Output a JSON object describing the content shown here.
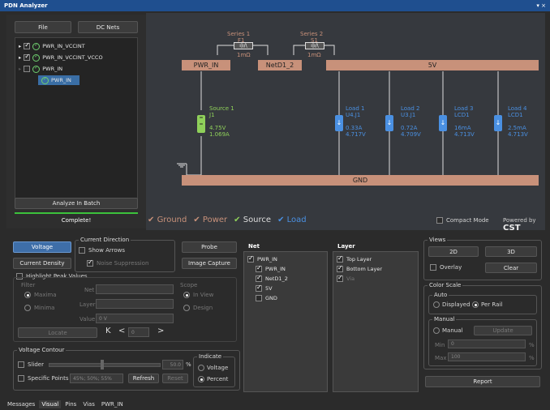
{
  "window": {
    "title": "PDN Analyzer",
    "controls": "▾ ×"
  },
  "left": {
    "file_btn": "File",
    "dcnets_btn": "DC Nets",
    "tree": [
      {
        "label": "PWR_IN_VCCINT"
      },
      {
        "label": "PWR_IN_VCCINT_VCCO"
      },
      {
        "label": "PWR_IN"
      },
      {
        "label": "PWR_IN"
      }
    ],
    "analyze_btn": "Analyze In Batch",
    "status": "Complete!"
  },
  "schem": {
    "series1": {
      "title": "Series 1",
      "ref": "F1",
      "val": "1mΩ"
    },
    "series2": {
      "title": "Series 2",
      "ref": "S1",
      "val": "1mΩ"
    },
    "nets": {
      "pwr_in": "PWR_IN",
      "netd1": "NetD1_2",
      "fivev": "5V",
      "gnd": "GND"
    },
    "source": {
      "title": "Source 1",
      "ref": "J1",
      "v": "4.75V",
      "i": "1.069A"
    },
    "loads": [
      {
        "title": "Load 1",
        "ref": "U4.J1",
        "a": "0.33A",
        "v": "4.717V"
      },
      {
        "title": "Load 2",
        "ref": "U3.J1",
        "a": "0.72A",
        "v": "4.709V"
      },
      {
        "title": "Load 3",
        "ref": "LCD1",
        "a": "16mA",
        "v": "4.713V"
      },
      {
        "title": "Load 4",
        "ref": "LCD1",
        "a": "2.5mA",
        "v": "4.713V"
      }
    ],
    "legend": {
      "ground": "Ground",
      "power": "Power",
      "source": "Source",
      "load": "Load"
    },
    "compact": "Compact Mode",
    "powered": "Powered by",
    "cst": "CST"
  },
  "ctrl": {
    "voltage_btn": "Voltage",
    "density_btn": "Current Density",
    "curdir": {
      "title": "Current Direction",
      "show": "Show Arrows",
      "noise": "Noise Suppression"
    },
    "probe": "Probe",
    "capture": "Image Capture",
    "peak": {
      "title": "Highlight Peak Values",
      "filter": "Filter",
      "maxima": "Maxima",
      "minima": "Minima",
      "net": "Net",
      "layer": "Layer",
      "value": "Value",
      "value_val": "0 V",
      "scope": "Scope",
      "inview": "In View",
      "design": "Design",
      "locate": "Locate",
      "page": "0"
    },
    "contour": {
      "title": "Voltage Contour",
      "slider": "Slider",
      "slider_val": "50.0",
      "pct": "%",
      "specific": "Specific Points",
      "specific_val": "45%; 50%; 55%",
      "refresh": "Refresh",
      "reset": "Reset",
      "indicate": "Indicate",
      "voltage": "Voltage",
      "percent": "Percent"
    },
    "net": {
      "title": "Net",
      "items": [
        "PWR_IN",
        "PWR_IN",
        "NetD1_2",
        "5V",
        "GND"
      ]
    },
    "layer": {
      "title": "Layer",
      "items": [
        "Top Layer",
        "Bottom Layer",
        "Via"
      ]
    },
    "views": {
      "title": "Views",
      "b2d": "2D",
      "b3d": "3D",
      "overlay": "Overlay",
      "clear": "Clear"
    },
    "scale": {
      "title": "Color Scale",
      "auto": "Auto",
      "displayed": "Displayed",
      "perrail": "Per Rail",
      "manual_grp": "Manual",
      "manual": "Manual",
      "update": "Update",
      "min": "Min",
      "min_val": "0",
      "max": "Max",
      "max_val": "100",
      "pct": "%"
    },
    "report": "Report"
  },
  "tabs": [
    "Messages",
    "Visual",
    "Pins",
    "Vias",
    "PWR_IN"
  ],
  "colors": {
    "rail": "#c8917a",
    "source": "#8fd05a",
    "load": "#4a90e2"
  }
}
